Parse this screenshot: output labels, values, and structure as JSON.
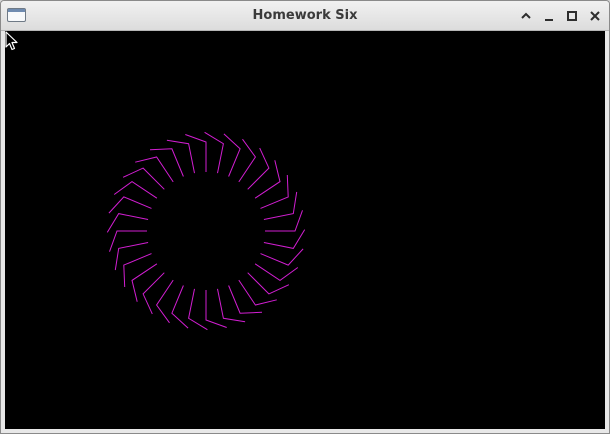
{
  "window": {
    "title": "Homework Six"
  },
  "controls": {
    "shade": "chevron-up-icon",
    "minimize": "minimize-icon",
    "maximize": "maximize-icon",
    "close": "close-icon"
  },
  "canvas": {
    "background": "#000000",
    "stroke_color": "#d21ed2",
    "spoke_count": 32
  }
}
